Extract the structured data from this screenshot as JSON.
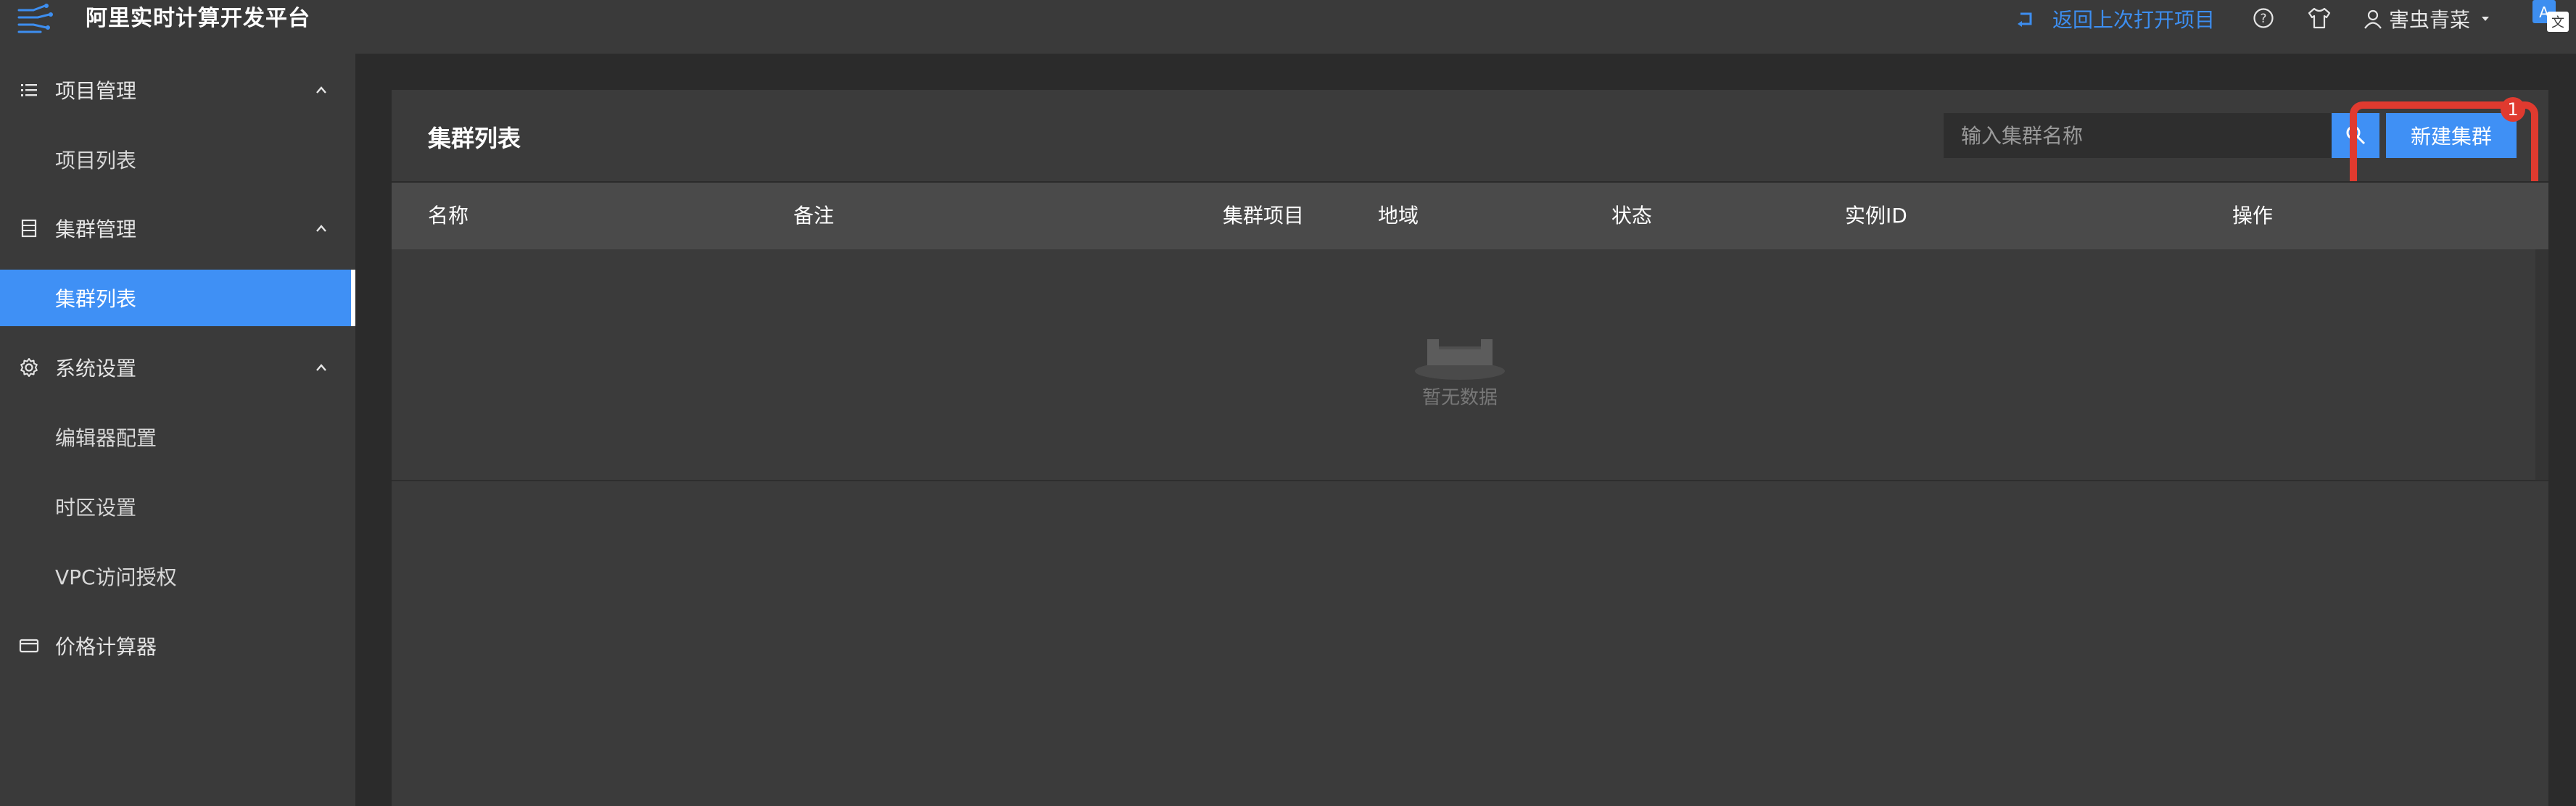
{
  "app": {
    "title": "阿里实时计算开发平台"
  },
  "header": {
    "return_label": "返回上次打开项目",
    "username": "害虫青菜"
  },
  "sidebar": {
    "groups": [
      {
        "label": "项目管理",
        "icon": "list-icon",
        "items": [
          {
            "label": "项目列表"
          }
        ]
      },
      {
        "label": "集群管理",
        "icon": "server-icon",
        "items": [
          {
            "label": "集群列表",
            "active": true
          }
        ]
      },
      {
        "label": "系统设置",
        "icon": "gear-icon",
        "items": [
          {
            "label": "编辑器配置"
          },
          {
            "label": "时区设置"
          },
          {
            "label": "VPC访问授权"
          }
        ]
      },
      {
        "label": "价格计算器",
        "icon": "card-icon",
        "items": []
      }
    ]
  },
  "main": {
    "title": "集群列表",
    "search_placeholder": "输入集群名称",
    "new_button_label": "新建集群",
    "badge_count": "1",
    "columns": [
      "名称",
      "备注",
      "集群项目",
      "地域",
      "状态",
      "实例ID",
      "操作"
    ],
    "empty_text": "暂无数据"
  },
  "colors": {
    "accent": "#3f90f5",
    "highlight": "#e03a2f",
    "background": "#2b2b2b",
    "panel": "#3a3a3a"
  }
}
